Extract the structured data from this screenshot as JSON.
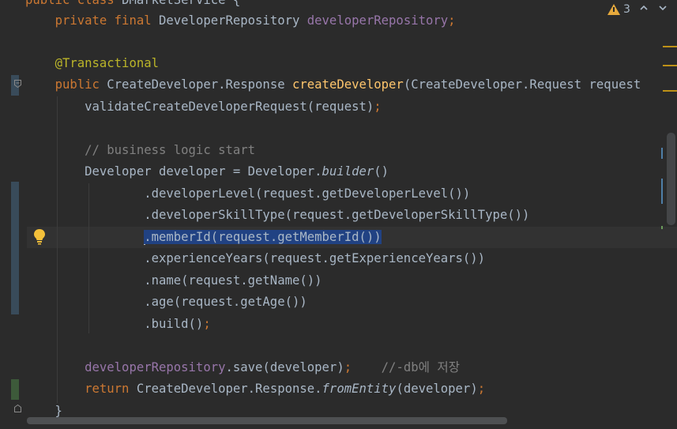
{
  "editor": {
    "lines": [
      [
        {
          "t": "public class ",
          "c": "kw"
        },
        {
          "t": "DMarketService {",
          "c": ""
        }
      ],
      [
        {
          "t": "    ",
          "c": ""
        },
        {
          "t": "private final ",
          "c": "kw"
        },
        {
          "t": "DeveloperRepository ",
          "c": ""
        },
        {
          "t": "developerRepository",
          "c": "fld"
        },
        {
          "t": ";",
          "c": "kw"
        }
      ],
      [],
      [
        {
          "t": "    ",
          "c": ""
        },
        {
          "t": "@Transactional",
          "c": "ann"
        }
      ],
      [
        {
          "t": "    ",
          "c": ""
        },
        {
          "t": "public ",
          "c": "kw"
        },
        {
          "t": "CreateDeveloper.Response ",
          "c": ""
        },
        {
          "t": "createDeveloper",
          "c": "fn"
        },
        {
          "t": "(CreateDeveloper.Request request",
          "c": ""
        }
      ],
      [
        {
          "t": "        validateCreateDeveloperRequest(request)",
          "c": ""
        },
        {
          "t": ";",
          "c": "kw"
        }
      ],
      [],
      [
        {
          "t": "        // business logic start",
          "c": "cmt"
        }
      ],
      [
        {
          "t": "        Developer developer = Developer.",
          "c": ""
        },
        {
          "t": "builder",
          "c": "it"
        },
        {
          "t": "()",
          "c": ""
        }
      ],
      [
        {
          "t": "                .developerLevel(request.getDeveloperLevel())",
          "c": ""
        }
      ],
      [
        {
          "t": "                .developerSkillType(request.getDeveloperSkillType())",
          "c": ""
        }
      ],
      [
        {
          "t": "                ",
          "c": ""
        },
        {
          "t": "|",
          "c": "caret"
        },
        {
          "t": ".memberId(request.getMemberId())",
          "c": "sel"
        }
      ],
      [
        {
          "t": "                .experienceYears(request.getExperienceYears())",
          "c": ""
        }
      ],
      [
        {
          "t": "                .name(request.getName())",
          "c": ""
        }
      ],
      [
        {
          "t": "                .age(request.getAge())",
          "c": ""
        }
      ],
      [
        {
          "t": "                .build()",
          "c": ""
        },
        {
          "t": ";",
          "c": "kw"
        }
      ],
      [],
      [
        {
          "t": "        ",
          "c": ""
        },
        {
          "t": "developerRepository",
          "c": "fld"
        },
        {
          "t": ".save(developer)",
          "c": ""
        },
        {
          "t": ";",
          "c": "kw"
        },
        {
          "t": "    //-db에 저장",
          "c": "cmt"
        }
      ],
      [
        {
          "t": "        ",
          "c": ""
        },
        {
          "t": "return ",
          "c": "kw"
        },
        {
          "t": "CreateDeveloper.Response.",
          "c": ""
        },
        {
          "t": "fromEntity",
          "c": "it"
        },
        {
          "t": "(developer)",
          "c": ""
        },
        {
          "t": ";",
          "c": "kw"
        }
      ],
      [
        {
          "t": "    }",
          "c": ""
        }
      ]
    ]
  },
  "inspections": {
    "warning_count": "3",
    "warning_icon": "warning-triangle-icon",
    "prev_label": "⌃",
    "next_label": "⌄"
  },
  "gutter": {
    "intention_icon": "lightbulb-icon"
  }
}
